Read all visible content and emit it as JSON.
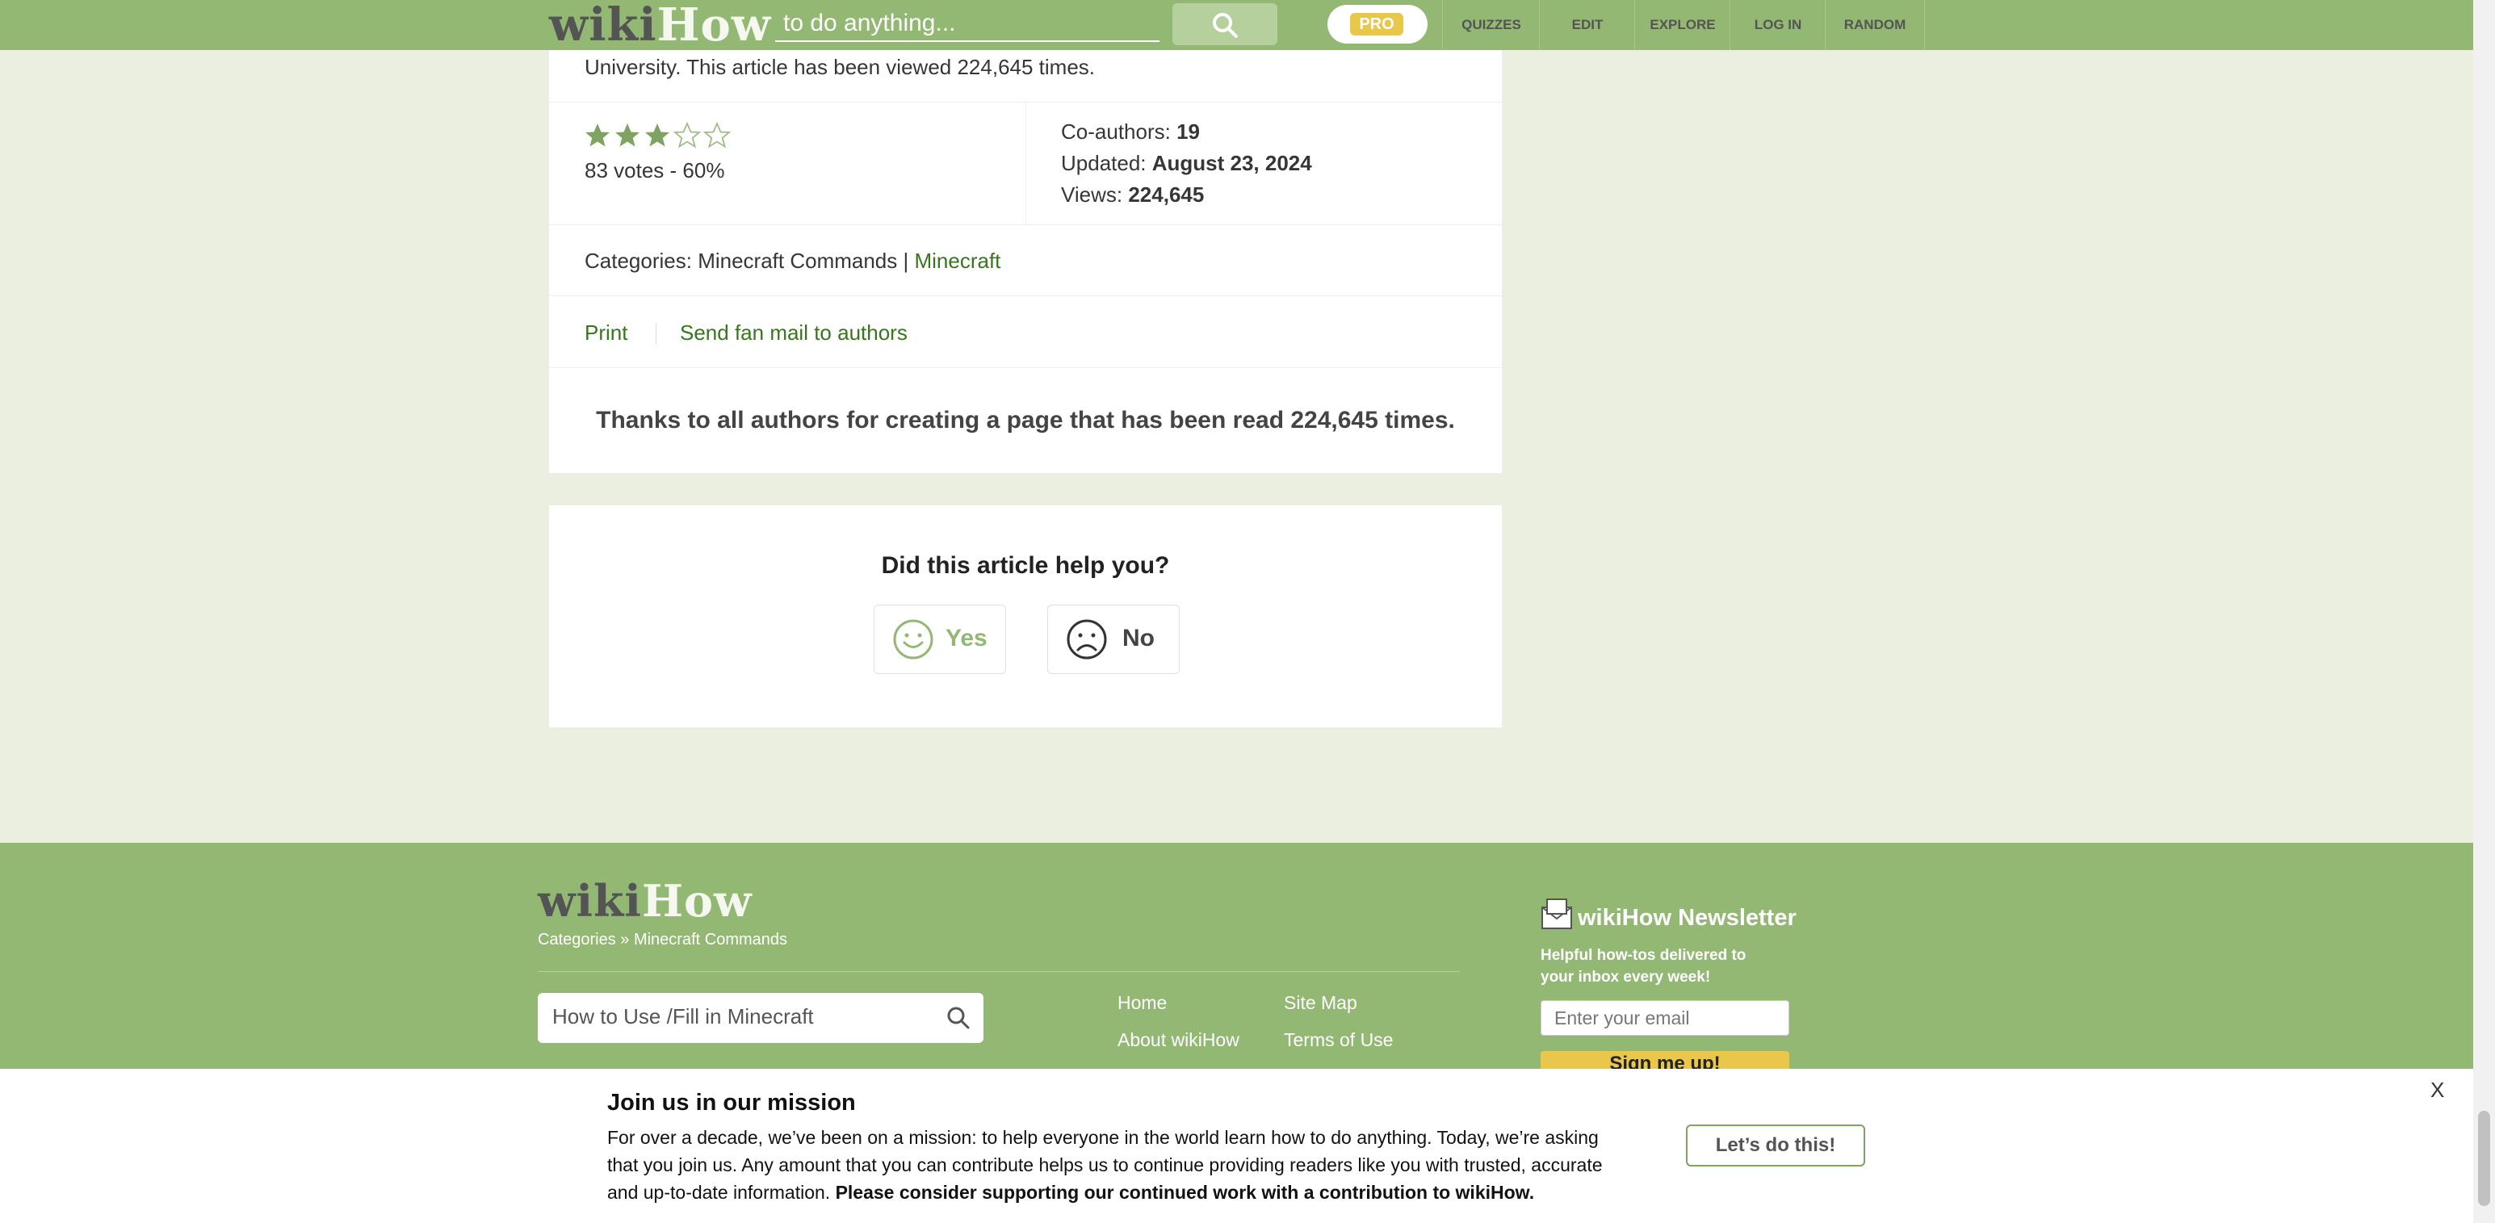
{
  "header": {
    "logo_wiki": "wiki",
    "logo_how": "How",
    "search_placeholder": "to do anything...",
    "pro_label": "PRO",
    "nav": [
      "QUIZZES",
      "EDIT",
      "EXPLORE",
      "LOG IN",
      "RANDOM"
    ]
  },
  "article": {
    "viewed_text": "University. This article has been viewed 224,645 times.",
    "rating": {
      "stars_filled": 3,
      "stars_total": 5,
      "votes_text": "83 votes - 60%"
    },
    "meta": {
      "coauthors_label": "Co-authors: ",
      "coauthors_value": "19",
      "updated_label": "Updated: ",
      "updated_value": "August 23, 2024",
      "views_label": "Views: ",
      "views_value": "224,645"
    },
    "categories_label": "Categories: ",
    "category1": "Minecraft Commands",
    "separator": " | ",
    "category2": "Minecraft",
    "print_label": "Print",
    "fanmail_label": "Send fan mail to authors",
    "thanks_text": "Thanks to all authors for creating a page that has been read 224,645 times."
  },
  "helpful": {
    "question": "Did this article help you?",
    "yes_label": "Yes",
    "no_label": "No"
  },
  "footer": {
    "logo_wiki": "wiki",
    "logo_how": "How",
    "breadcrumb": "Categories » Minecraft Commands",
    "search_value": "How to Use /Fill in Minecraft",
    "links": [
      "Home",
      "Site Map",
      "About wikiHow",
      "Terms of Use"
    ],
    "newsletter_title": "wikiHow Newsletter",
    "newsletter_desc_1": "Helpful how-tos delivered to",
    "newsletter_desc_2": "your inbox every week!",
    "email_placeholder": "Enter your email",
    "signup_label": "Sign me up!"
  },
  "banner": {
    "title": "Join us in our mission",
    "line1": "For over a decade, we’ve been on a mission: to help everyone in the world learn how to do anything. Today, we’re asking",
    "line2": "that you join us. Any amount that you can contribute helps us to continue providing readers like you with trusted, accurate",
    "line3_plain": "and up-to-date information. ",
    "line3_bold": "Please consider supporting our continued work with a contribution to wikiHow.",
    "cta_label": "Let’s do this!",
    "close_label": "X"
  },
  "colors": {
    "brand_green": "#93b874",
    "link_green": "#38761d",
    "star_green": "#7fa362",
    "pro_yellow": "#e8c74a"
  }
}
